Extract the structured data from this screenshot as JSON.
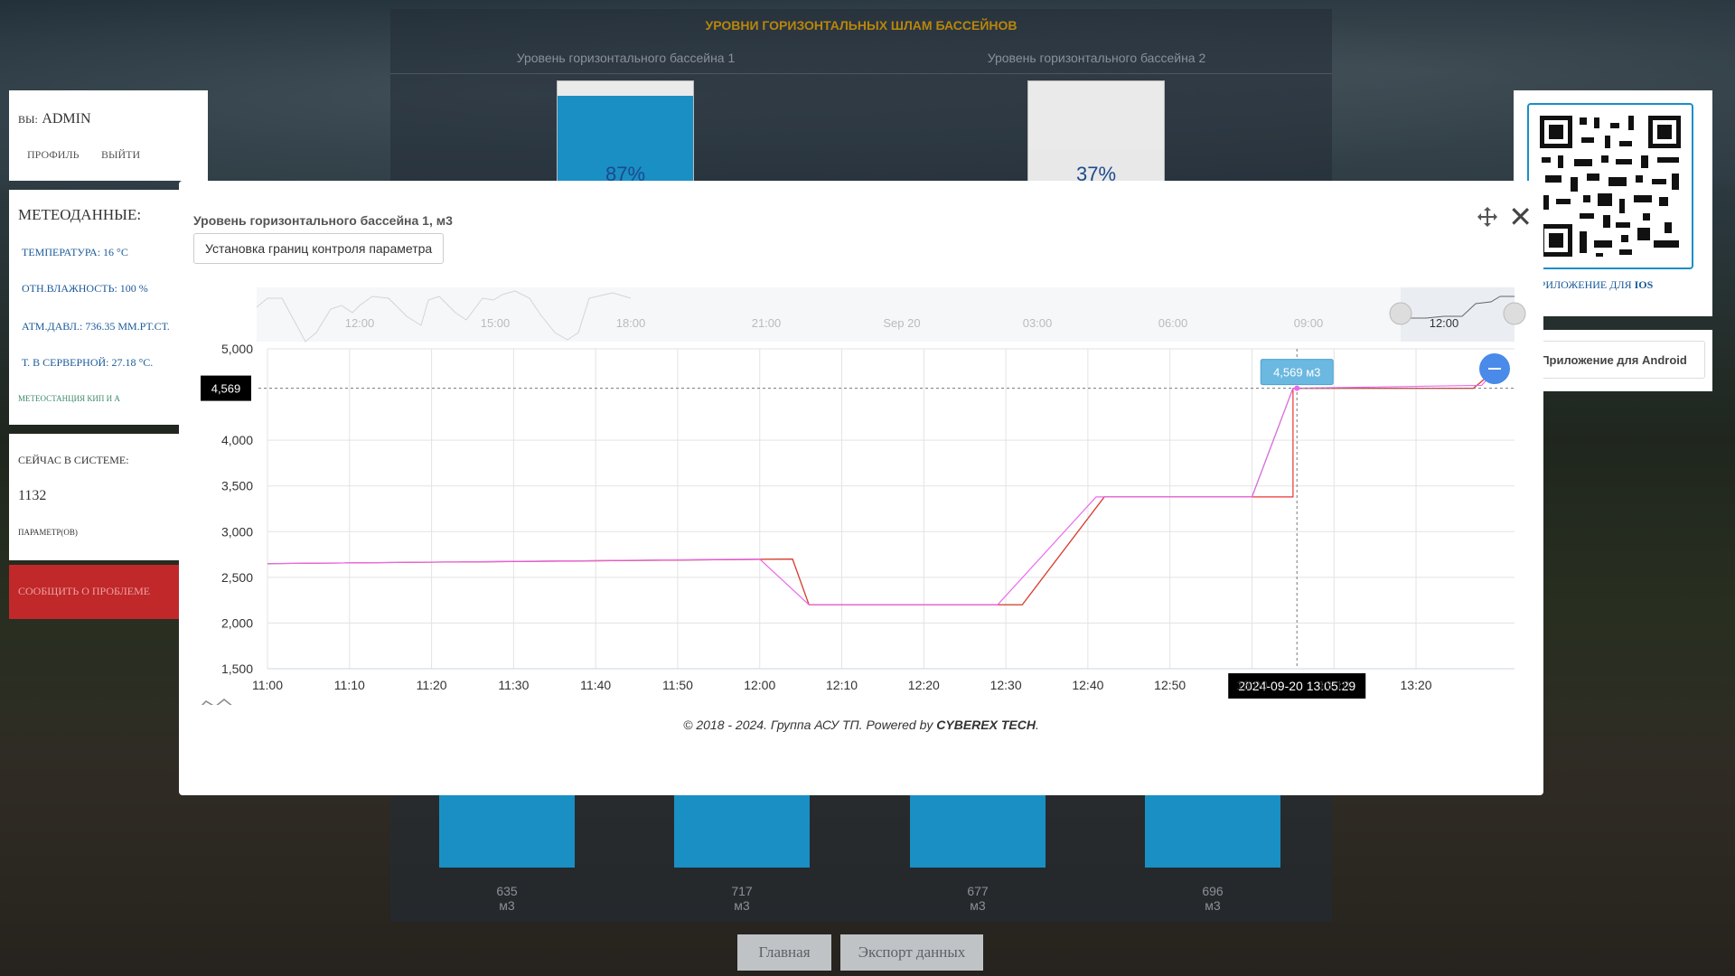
{
  "header": {
    "title": "УРОВНИ ГОРИЗОНТАЛЬНЫХ ШЛАМ БАССЕЙНОВ",
    "pool1_label": "Уровень горизонтального бассейна 1",
    "pool2_label": "Уровень горизонтального бассейна 2",
    "pool1_pct": "87%",
    "pool2_pct": "37%",
    "pool1_level": 0.87,
    "pool2_level": 0.37
  },
  "user": {
    "you_label": "ВЫ:",
    "name": "ADMIN",
    "profile": "ПРОФИЛЬ",
    "logout": "ВЫЙТИ"
  },
  "meteo": {
    "title": "МЕТЕОДАННЫЕ:",
    "temperature": "ТЕМПЕРАТУРА: 16 °C",
    "humidity": "ОТН.ВЛАЖНОСТЬ: 100 %",
    "pressure": "АТМ.ДАВЛ.: 736.35 ММ.РТ.СТ.",
    "server_temp": "Т. В СЕРВЕРНОЙ: 27.18 °C.",
    "station": "МЕТЕОСТАНЦИЯ КИП И А"
  },
  "system": {
    "title": "СЕЙЧАС В СИСТЕМЕ:",
    "count": "1132",
    "params": "ПАРАМЕТР(ОВ)"
  },
  "report_problem": "СООБЩИТЬ О ПРОБЛЕМЕ",
  "right_panel": {
    "ios_label_prefix": "ПРИЛОЖЕНИЕ ДЛЯ ",
    "ios_label_bold": "IOS",
    "android_button": "Приложение для Android"
  },
  "bottom_tanks": [
    {
      "value": "635",
      "unit": "м3"
    },
    {
      "value": "717",
      "unit": "м3"
    },
    {
      "value": "677",
      "unit": "м3"
    },
    {
      "value": "696",
      "unit": "м3"
    }
  ],
  "nav": {
    "home": "Главная",
    "export": "Экспорт данных"
  },
  "modal": {
    "title": "Уровень горизонтального бассейна 1, м3",
    "limits_button": "Установка границ контроля параметра",
    "footer_prefix": "© 2018 - 2024. Группа АСУ ТП. Powered by ",
    "footer_brand": "CYBEREX TECH",
    "footer_suffix": "."
  },
  "chart_data": {
    "type": "line",
    "title": "Уровень горизонтального бассейна 1, м3",
    "xlabel": "",
    "ylabel": "",
    "ylim": [
      1500,
      5000
    ],
    "y_ticks": [
      "1,500",
      "2,000",
      "2,500",
      "3,000",
      "3,500",
      "4,000",
      "5,000"
    ],
    "x_ticks": [
      "11:00",
      "11:10",
      "11:20",
      "11:30",
      "11:40",
      "11:50",
      "12:00",
      "12:10",
      "12:20",
      "12:30",
      "12:40",
      "12:50",
      "13:00",
      "13:10",
      "13:20"
    ],
    "navigator_ticks": [
      "12:00",
      "15:00",
      "18:00",
      "21:00",
      "Sep 20",
      "03:00",
      "06:00",
      "09:00",
      "12:00"
    ],
    "grid": true,
    "crosshair": {
      "x_label": "2024-09-20 13:05:29",
      "y_label": "4,569",
      "tooltip": "4,569 м3"
    },
    "series": [
      {
        "color": "#22bb44",
        "x": [
          "11:00",
          "12:04",
          "12:06",
          "12:32",
          "12:42",
          "13:00",
          "13:05",
          "13:10",
          "13:27",
          "13:29"
        ],
        "values": [
          2650,
          2700,
          2200,
          2200,
          3380,
          3380,
          4569,
          4569,
          4569,
          4720
        ]
      },
      {
        "color": "#ee3333",
        "x": [
          "11:00",
          "12:04",
          "12:06",
          "12:32",
          "12:42",
          "13:05",
          "13:05",
          "13:27",
          "13:29"
        ],
        "values": [
          2650,
          2700,
          2200,
          2200,
          3380,
          3380,
          4569,
          4569,
          4720
        ]
      },
      {
        "color": "#ee66ee",
        "x": [
          "11:00",
          "12:00",
          "12:06",
          "12:29",
          "12:41",
          "13:00",
          "13:05",
          "13:28",
          "13:30"
        ],
        "values": [
          2650,
          2700,
          2200,
          2200,
          3380,
          3380,
          4569,
          4600,
          4800
        ]
      }
    ]
  }
}
